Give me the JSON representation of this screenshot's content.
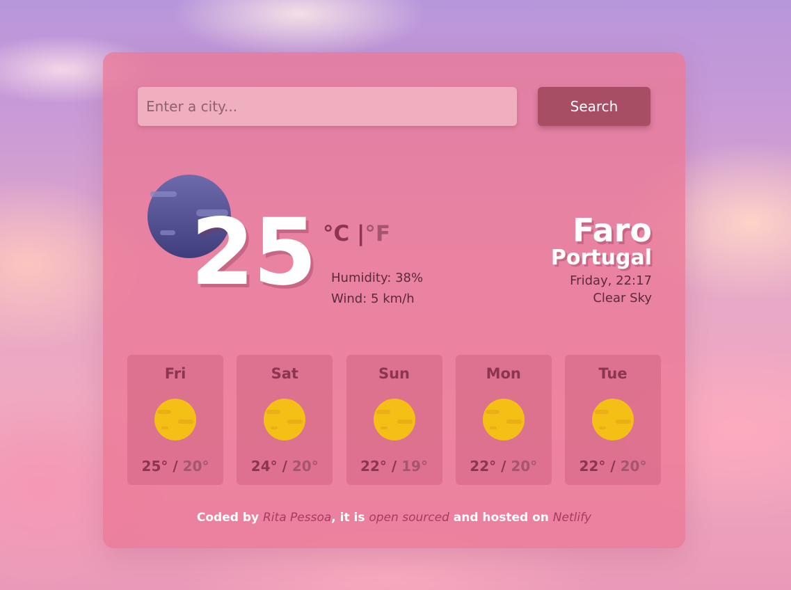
{
  "search": {
    "placeholder": "Enter a city...",
    "value": "",
    "button_label": "Search"
  },
  "current": {
    "icon": "moon-clouds-icon",
    "temperature": "25",
    "unit_c": "°C",
    "separator": " |",
    "unit_f": "°F",
    "humidity": "Humidity: 38%",
    "wind": "Wind: 5 km/h"
  },
  "location": {
    "city": "Faro",
    "country": "Portugal",
    "datetime": "Friday, 22:17",
    "condition": "Clear Sky"
  },
  "forecast": [
    {
      "day": "Fri",
      "icon": "sun-icon",
      "max": "25°",
      "sep": " / ",
      "min": "20°"
    },
    {
      "day": "Sat",
      "icon": "sun-icon",
      "max": "24°",
      "sep": " / ",
      "min": "20°"
    },
    {
      "day": "Sun",
      "icon": "sun-icon",
      "max": "22°",
      "sep": " / ",
      "min": "19°"
    },
    {
      "day": "Mon",
      "icon": "sun-icon",
      "max": "22°",
      "sep": " / ",
      "min": "20°"
    },
    {
      "day": "Tue",
      "icon": "sun-icon",
      "max": "22°",
      "sep": " / ",
      "min": "20°"
    }
  ],
  "footer": {
    "prefix": "Coded by ",
    "author": "Rita Pessoa",
    "middle1": ", it is ",
    "open_source": "open sourced",
    "middle2": " and hosted on ",
    "host": "Netlify"
  },
  "colors": {
    "card": "#ea7896",
    "button": "#a84e64",
    "input": "#f0afbe",
    "accent_text": "#8b3551",
    "sun": "#f5c016",
    "moon": "#5c5a9c"
  }
}
